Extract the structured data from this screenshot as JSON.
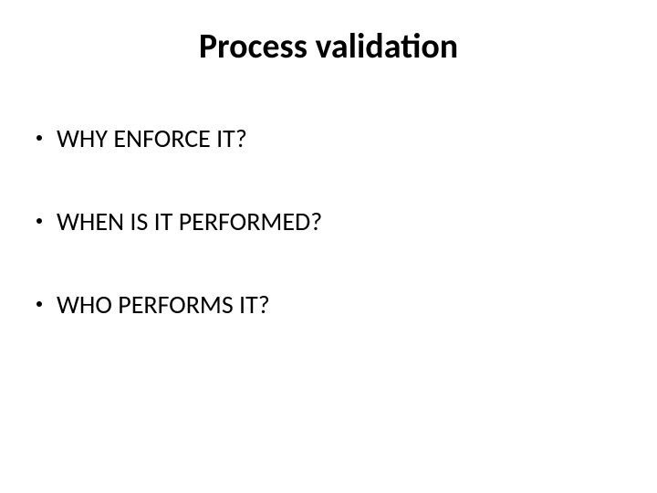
{
  "slide": {
    "title": "Process validation",
    "bullets": [
      "WHY ENFORCE IT?",
      "WHEN IS IT PERFORMED?",
      "WHO PERFORMS IT?"
    ]
  }
}
